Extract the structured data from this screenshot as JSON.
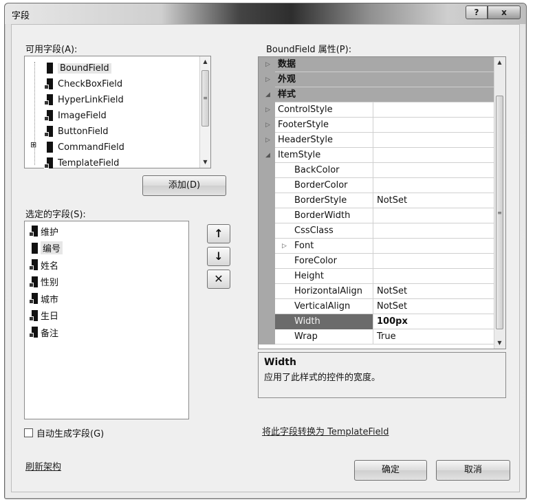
{
  "window": {
    "title": "字段",
    "help_label": "?",
    "close_label": "x"
  },
  "available": {
    "label": "可用字段(A):",
    "items": [
      {
        "label": "BoundField",
        "icon": "boundfield-icon"
      },
      {
        "label": "CheckBoxField",
        "icon": "checkboxfield-icon"
      },
      {
        "label": "HyperLinkField",
        "icon": "hyperlinkfield-icon"
      },
      {
        "label": "ImageField",
        "icon": "imagefield-icon"
      },
      {
        "label": "ButtonField",
        "icon": "buttonfield-icon"
      },
      {
        "label": "CommandField",
        "icon": "commandfield-icon"
      },
      {
        "label": "TemplateField",
        "icon": "templatefield-icon"
      }
    ],
    "expander": "⊞"
  },
  "add_button": "添加(D)",
  "selected": {
    "label": "选定的字段(S):",
    "items": [
      "维护",
      "编号",
      "姓名",
      "性别",
      "城市",
      "生日",
      "备注"
    ]
  },
  "move_buttons": {
    "up": "↑",
    "down": "↓",
    "delete": "✕"
  },
  "autogen": {
    "label": "自动生成字段(G)",
    "checked": false
  },
  "refresh_link": "刷新架构",
  "properties": {
    "label": "BoundField 属性(P):",
    "toolbar": [
      "categorized-icon",
      "alphabetical-icon",
      "property-pages-icon"
    ],
    "rows": [
      {
        "kind": "cat",
        "name": "数据",
        "expander": "▷",
        "value": ""
      },
      {
        "kind": "cat",
        "name": "外观",
        "expander": "▷",
        "value": ""
      },
      {
        "kind": "cat",
        "name": "样式",
        "expander": "◢",
        "value": ""
      },
      {
        "kind": "prop",
        "name": "ControlStyle",
        "expander": "▷",
        "value": ""
      },
      {
        "kind": "prop",
        "name": "FooterStyle",
        "expander": "▷",
        "value": ""
      },
      {
        "kind": "prop",
        "name": "HeaderStyle",
        "expander": "▷",
        "value": ""
      },
      {
        "kind": "prop",
        "name": "ItemStyle",
        "expander": "◢",
        "value": ""
      },
      {
        "kind": "sub",
        "name": "BackColor",
        "expander": "",
        "value": ""
      },
      {
        "kind": "sub",
        "name": "BorderColor",
        "expander": "",
        "value": ""
      },
      {
        "kind": "sub",
        "name": "BorderStyle",
        "expander": "",
        "value": "NotSet"
      },
      {
        "kind": "sub",
        "name": "BorderWidth",
        "expander": "",
        "value": ""
      },
      {
        "kind": "sub",
        "name": "CssClass",
        "expander": "",
        "value": ""
      },
      {
        "kind": "sub",
        "name": "Font",
        "expander": "▷",
        "value": ""
      },
      {
        "kind": "sub",
        "name": "ForeColor",
        "expander": "",
        "value": ""
      },
      {
        "kind": "sub",
        "name": "Height",
        "expander": "",
        "value": ""
      },
      {
        "kind": "sub",
        "name": "HorizontalAlign",
        "expander": "",
        "value": "NotSet"
      },
      {
        "kind": "sub",
        "name": "VerticalAlign",
        "expander": "",
        "value": "NotSet"
      },
      {
        "kind": "sub",
        "name": "Width",
        "expander": "",
        "value": "100px",
        "selected": true
      },
      {
        "kind": "sub",
        "name": "Wrap",
        "expander": "",
        "value": "True"
      }
    ],
    "description_title": "Width",
    "description_text": "应用了此样式的控件的宽度。"
  },
  "convert_link": "将此字段转换为 TemplateField",
  "ok_button": "确定",
  "cancel_button": "取消"
}
